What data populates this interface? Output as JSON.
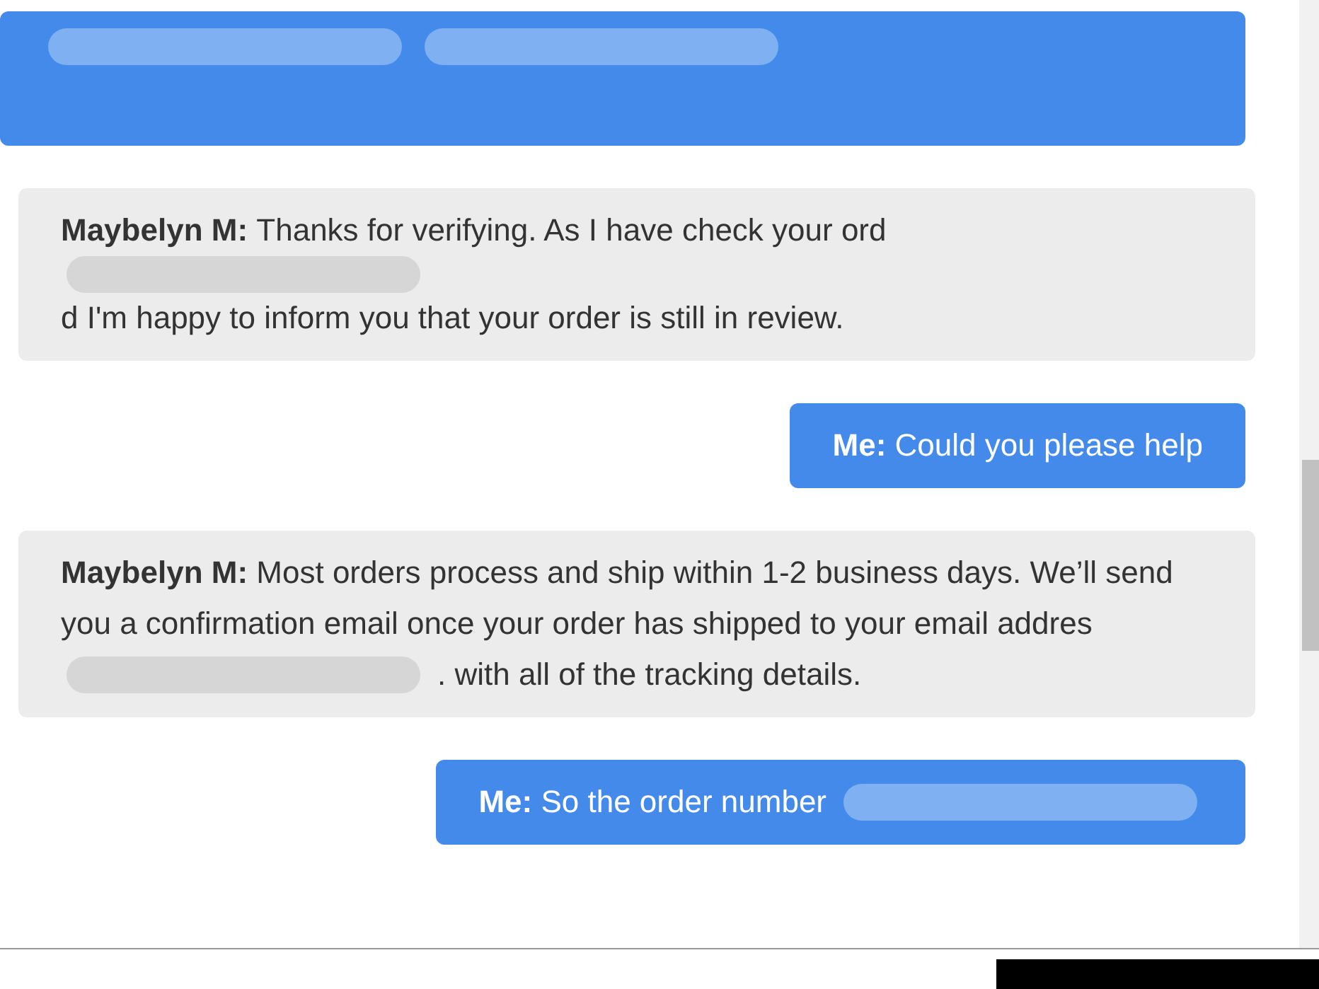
{
  "messages": [
    {
      "kind": "me",
      "parts": [
        {
          "kind": "redacted"
        },
        {
          "kind": "redacted"
        }
      ]
    },
    {
      "kind": "agent",
      "name": "Maybelyn M:",
      "parts": [
        {
          "kind": "text",
          "text": "Thanks for verifying. As I have check your ord"
        },
        {
          "kind": "redacted"
        },
        {
          "kind": "text",
          "text": "d I'm happy to inform you that your order is still in review."
        }
      ]
    },
    {
      "kind": "me",
      "name": "Me:",
      "parts": [
        {
          "kind": "text",
          "text": "Could you please help"
        }
      ]
    },
    {
      "kind": "agent",
      "name": "Maybelyn M:",
      "parts": [
        {
          "kind": "text",
          "text": "Most orders process and ship within 1-2 business days. We’ll send you a confirmation email once your order has shipped to your email addres"
        },
        {
          "kind": "redacted"
        },
        {
          "kind": "text",
          "text": ". with all of the tracking details."
        }
      ]
    },
    {
      "kind": "me",
      "name": "Me:",
      "parts": [
        {
          "kind": "text",
          "text": "So the order number"
        },
        {
          "kind": "redacted"
        }
      ]
    }
  ]
}
